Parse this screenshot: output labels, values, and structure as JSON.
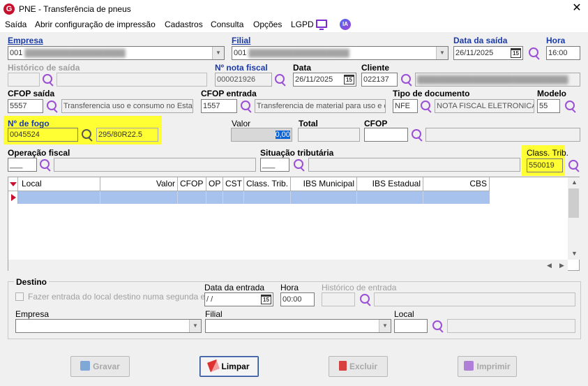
{
  "window": {
    "title": "PNE - Transferência de pneus",
    "close": "✕",
    "app_icon": "G"
  },
  "menu": {
    "items": [
      "Saída",
      "Abrir configuração de impressão",
      "Cadastros",
      "Consulta",
      "Opções",
      "LGPD"
    ],
    "ia_label": "IA"
  },
  "labels": {
    "empresa": "Empresa",
    "filial": "Filial",
    "data_saida": "Data da saída",
    "hora": "Hora",
    "historico_saida": "Histórico de saída",
    "nota_fiscal": "Nº nota fiscal",
    "data": "Data",
    "cliente": "Cliente",
    "cfop_saida": "CFOP saída",
    "cfop_entrada": "CFOP entrada",
    "tipo_documento": "Tipo de documento",
    "modelo": "Modelo",
    "n_fogo": "Nº de fogo",
    "valor": "Valor",
    "total": "Total",
    "cfop": "CFOP",
    "operacao_fiscal": "Operação fiscal",
    "situacao_tributaria": "Situação tributária",
    "class_trib": "Class. Trib."
  },
  "fields": {
    "empresa_code": "001",
    "empresa_name": "▓▓▓▓▓▓▓▓▓▓▓▓▓▓▓▓▓▓",
    "filial_code": "001",
    "filial_name": "▓▓▓▓▓▓▓▓▓▓▓▓▓▓▓▓▓▓",
    "data_saida": "26/11/2025",
    "hora": "16:00",
    "nota_fiscal": "000021926",
    "data": "26/11/2025",
    "cliente_code": "022137",
    "cliente_name": "▓▓▓▓▓▓▓▓▓▓▓▓▓▓▓▓▓▓▓▓▓▓▓▓▓▓▓",
    "cfop_saida": "5557",
    "cfop_saida_desc": "Transferencia uso e consumo no Estac",
    "cfop_entrada": "1557",
    "cfop_entrada_desc": "Transferencia de material para uso e cc",
    "tipo_documento": "NFE",
    "tipo_documento_desc": "NOTA FISCAL ELETRONICA",
    "modelo": "55",
    "n_fogo": "0045524",
    "n_fogo_desc": "295/80R22.5",
    "valor": "0,00",
    "operacao_fiscal": "___",
    "situacao_tributaria": "___",
    "class_trib": "550019"
  },
  "grid": {
    "columns": [
      "Local",
      "Valor",
      "CFOP",
      "OP",
      "CST",
      "Class. Trib.",
      "IBS Municipal",
      "IBS Estadual",
      "CBS"
    ]
  },
  "destino": {
    "legend": "Destino",
    "checkbox_label": "Fazer entrada do local destino numa segunda etapa",
    "data_entrada_label": "Data da entrada",
    "data_entrada": " /  /",
    "hora_label": "Hora",
    "hora": "00:00",
    "historico_entrada_label": "Histórico de entrada",
    "empresa_label": "Empresa",
    "filial_label": "Filial",
    "local_label": "Local"
  },
  "buttons": {
    "gravar": "Gravar",
    "limpar": "Limpar",
    "excluir": "Excluir",
    "imprimir": "Imprimir"
  },
  "colors": {
    "label_blue": "#1a3aa8",
    "highlight": "#ffff33",
    "search_purple": "#9b4fd6",
    "row_selected": "#a8c2ee"
  }
}
